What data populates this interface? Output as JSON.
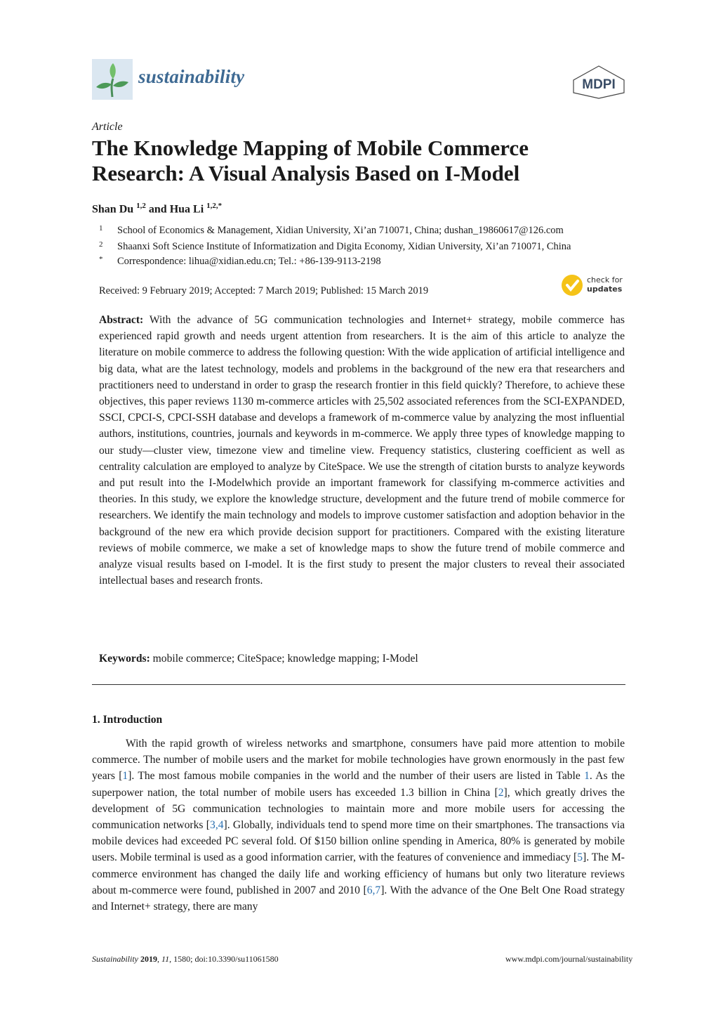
{
  "header": {
    "journal_name": "sustainability",
    "publisher_logo": "MDPI",
    "logo_icon": "plant-sprout-icon"
  },
  "article": {
    "type": "Article",
    "title": "The Knowledge Mapping of Mobile Commerce Research: A Visual Analysis Based on I-Model",
    "authors": [
      {
        "name": "Shan Du",
        "affil": "1,2"
      },
      {
        "name": "Hua Li",
        "affil": "1,2,*"
      }
    ],
    "author_connector": "and",
    "affiliations": [
      {
        "mark": "1",
        "text": "School of Economics & Management, Xidian University, Xi’an 710071, China; dushan_19860617@126.com"
      },
      {
        "mark": "2",
        "text": "Shaanxi Soft Science Institute of Informatization and Digita Economy, Xidian University, Xi’an 710071, China"
      },
      {
        "mark": "*",
        "text": "Correspondence: lihua@xidian.edu.cn; Tel.: +86-139-9113-2198"
      }
    ],
    "dates": "Received: 9 February 2019; Accepted: 7 March 2019; Published: 15 March 2019",
    "check_updates": {
      "line1": "check for",
      "line2": "updates"
    },
    "abstract_label": "Abstract:",
    "abstract": "With the advance of 5G communication technologies and Internet+ strategy, mobile commerce has experienced rapid growth and needs urgent attention from researchers.  It is the aim of this article to analyze the literature on mobile commerce to address the following question: With the wide application of artificial intelligence and big data, what are the latest technology, models and problems in the background of the new era that researchers and practitioners need to understand in order to grasp the research frontier in this field quickly? Therefore, to achieve these objectives, this paper reviews 1130 m-commerce articles with 25,502 associated references from the SCI-EXPANDED, SSCI, CPCI-S, CPCI-SSH database and develops a framework of m-commerce value by analyzing the most influential authors, institutions, countries, journals and keywords in m-commerce. We apply three types of knowledge mapping to our study—cluster view, timezone view and timeline view. Frequency statistics, clustering coefficient as well as centrality calculation are employed to analyze by CiteSpace. We use the strength of citation bursts to analyze keywords and put result into the I-Modelwhich provide an important framework for classifying m-commerce activities and theories. In this study, we explore the knowledge structure, development and the future trend of mobile commerce for researchers. We identify the main technology and models to improve customer satisfaction and adoption behavior in the background of the new era which provide decision support for practitioners. Compared with the existing literature reviews of mobile commerce, we make a set of knowledge maps to show the future trend of mobile commerce and analyze visual results based on I-model. It is the first study to present the major clusters to reveal their associated intellectual bases and research fronts.",
    "keywords_label": "Keywords:",
    "keywords": "mobile commerce; CiteSpace; knowledge mapping; I-Model"
  },
  "section": {
    "heading": "1. Introduction",
    "segments": [
      {
        "t": "With the rapid growth of wireless networks and smartphone, consumers have paid more attention to mobile commerce. The number of mobile users and the market for mobile technologies have grown enormously in the past few years ["
      },
      {
        "t": "1",
        "ref": true
      },
      {
        "t": "].  The most famous mobile companies in the world and the number of their users are listed in Table "
      },
      {
        "t": "1",
        "ref": true
      },
      {
        "t": ". As the superpower nation, the total number of mobile users has exceeded 1.3 billion in China ["
      },
      {
        "t": "2",
        "ref": true
      },
      {
        "t": "], which greatly drives the development of 5G communication technologies to maintain more and more mobile users for accessing the communication networks ["
      },
      {
        "t": "3,4",
        "ref": true
      },
      {
        "t": "]. Globally, individuals tend to spend more time on their smartphones.  The transactions via mobile devices had exceeded PC several fold. Of $150 billion online spending in America, 80% is generated by mobile users. Mobile terminal is used as a good information carrier, with the features of convenience and immediacy ["
      },
      {
        "t": "5",
        "ref": true
      },
      {
        "t": "]. The M-commerce environment has changed the daily life and working efficiency of humans but only two literature reviews about m-commerce were found, published in 2007 and 2010 ["
      },
      {
        "t": "6,7",
        "ref": true
      },
      {
        "t": "]. With the advance of the One Belt One Road strategy and Internet+ strategy, there are many"
      }
    ]
  },
  "footer": {
    "journal": "Sustainability",
    "year": "2019",
    "volume": "11",
    "rest": ", 1580; doi:10.3390/su11061580",
    "url": "www.mdpi.com/journal/sustainability"
  }
}
